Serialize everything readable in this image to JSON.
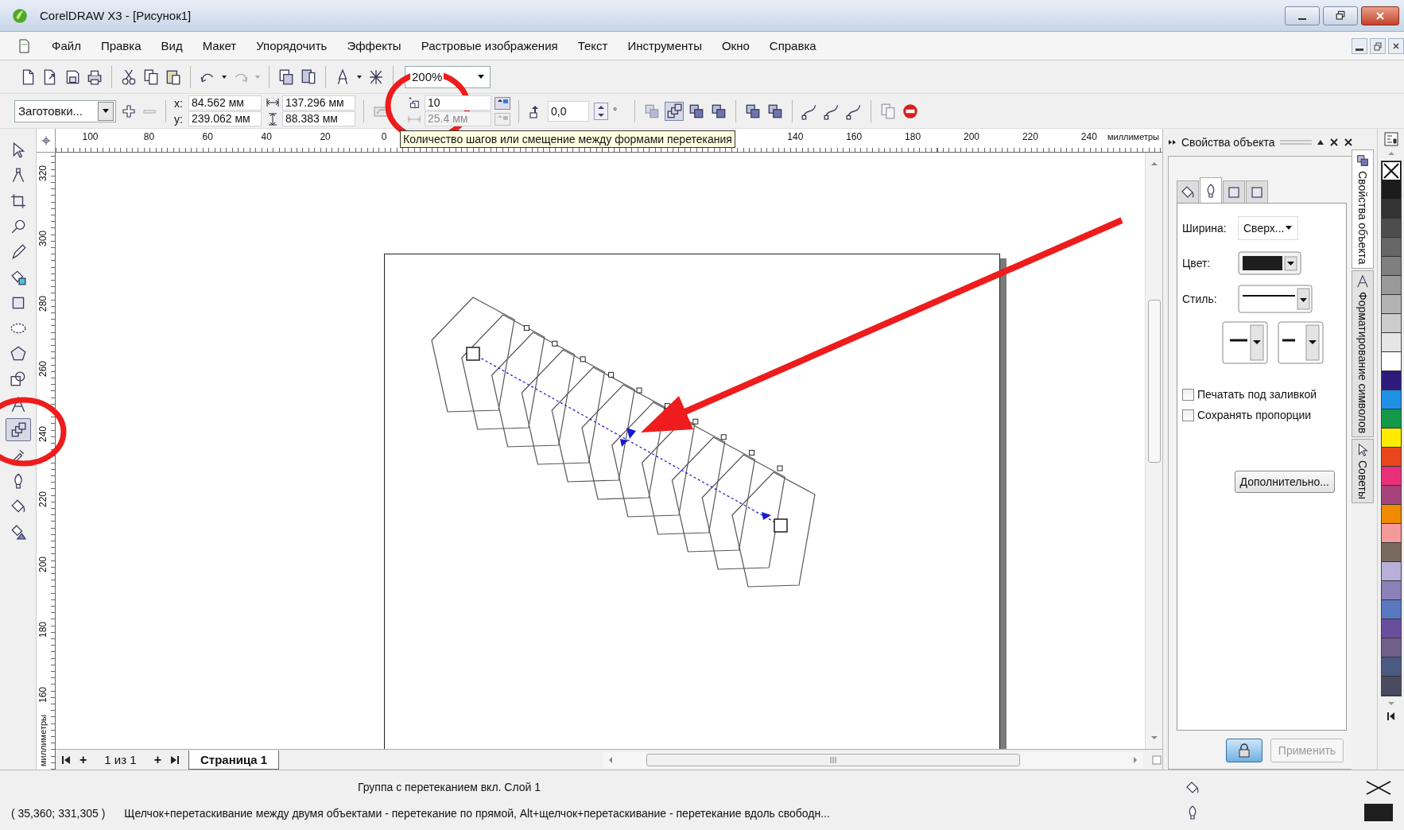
{
  "window": {
    "title": "CorelDRAW X3 - [Рисунок1]"
  },
  "menu": [
    "Файл",
    "Правка",
    "Вид",
    "Макет",
    "Упорядочить",
    "Эффекты",
    "Растровые изображения",
    "Текст",
    "Инструменты",
    "Окно",
    "Справка"
  ],
  "standard_toolbar": {
    "zoom": "200%"
  },
  "property_bar": {
    "preset": "Заготовки...",
    "x_label": "x:",
    "x": "84.562 мм",
    "y_label": "y:",
    "y": "239.062 мм",
    "width": "137.296 мм",
    "height": "88.383 мм",
    "steps": "10",
    "offset": {
      "value": "25.4 мм",
      "disabled": true
    },
    "angle": "0,0",
    "degree": "°"
  },
  "tooltip": "Количество шагов или смещение между формами перетекания",
  "horizontal_ruler": {
    "labels": [
      "100",
      "80",
      "60",
      "40",
      "20",
      "0",
      "140",
      "160",
      "180",
      "200",
      "220",
      "240"
    ],
    "unit": "миллиметры"
  },
  "vertical_ruler": {
    "labels": [
      "320",
      "300",
      "280",
      "260",
      "240",
      "220",
      "200",
      "180",
      "160"
    ],
    "unit": "миллиметры"
  },
  "toolbox": [
    {
      "selected": false
    },
    {
      "selected": false
    },
    {
      "selected": false
    },
    {
      "selected": false
    },
    {
      "selected": false
    },
    {
      "selected": false
    },
    {
      "selected": false
    },
    {
      "selected": false
    },
    {
      "selected": false
    },
    {
      "selected": false
    },
    {
      "selected": false
    },
    {
      "selected": true
    },
    {
      "selected": false
    },
    {
      "selected": false
    },
    {
      "selected": false
    },
    {
      "selected": false
    }
  ],
  "page_navigator": {
    "add_before": "+",
    "page_count": "1 из 1",
    "add_after": "+",
    "tabs": [
      {
        "label": "Страница 1",
        "selected": true
      }
    ]
  },
  "docker": {
    "title": "Свойства объекта",
    "tabs": [
      {
        "selected": false
      },
      {
        "selected": true
      },
      {
        "selected": false
      },
      {
        "selected": false
      }
    ],
    "width_label": "Ширина:",
    "width_value": "Сверх...",
    "color_label": "Цвет:",
    "style_label": "Стиль:",
    "checkboxes": [
      {
        "label": "Печатать под заливкой",
        "checked": false
      },
      {
        "label": "Сохранять пропорции",
        "checked": false
      }
    ],
    "advanced_button": "Дополнительно...",
    "apply_button": {
      "label": "Применить",
      "disabled": true
    }
  },
  "side_tabs": [
    {
      "label": "Свойства объекта",
      "selected": true
    },
    {
      "label": "Форматирование символов",
      "selected": false
    },
    {
      "label": "Советы",
      "selected": false
    }
  ],
  "palette": [
    {
      "kind": "none"
    },
    {
      "kind": "swatch",
      "color": "#1c1c1c"
    },
    {
      "kind": "swatch",
      "color": "#333333"
    },
    {
      "kind": "swatch",
      "color": "#4d4d4d"
    },
    {
      "kind": "swatch",
      "color": "#666666"
    },
    {
      "kind": "swatch",
      "color": "#7f7f7f"
    },
    {
      "kind": "swatch",
      "color": "#999999"
    },
    {
      "kind": "swatch",
      "color": "#b3b3b3"
    },
    {
      "kind": "swatch",
      "color": "#cccccc"
    },
    {
      "kind": "swatch",
      "color": "#e5e5e5"
    },
    {
      "kind": "swatch",
      "color": "#ffffff"
    },
    {
      "kind": "swatch",
      "color": "#2e1a7a"
    },
    {
      "kind": "swatch",
      "color": "#1e90e6"
    },
    {
      "kind": "swatch",
      "color": "#13994a"
    },
    {
      "kind": "swatch",
      "color": "#ffeb00"
    },
    {
      "kind": "swatch",
      "color": "#e8461c"
    },
    {
      "kind": "swatch",
      "color": "#e8307a"
    },
    {
      "kind": "swatch",
      "color": "#a54379"
    },
    {
      "kind": "swatch",
      "color": "#f08a00"
    },
    {
      "kind": "swatch",
      "color": "#f59a9a"
    },
    {
      "kind": "swatch",
      "color": "#7a6a5e"
    },
    {
      "kind": "swatch",
      "color": "#b8b0d8"
    },
    {
      "kind": "swatch",
      "color": "#8b80b8"
    },
    {
      "kind": "swatch",
      "color": "#5a78c0"
    },
    {
      "kind": "swatch",
      "color": "#6a4e9e"
    },
    {
      "kind": "swatch",
      "color": "#70608a"
    },
    {
      "kind": "swatch",
      "color": "#4a5a80"
    },
    {
      "kind": "swatch",
      "color": "#4a4a60"
    }
  ],
  "status_bar": {
    "object_info": "Группа с перетеканием вкл. Слой 1",
    "coordinates": "( 35,360; 331,305 )",
    "hint": "Щелчок+перетаскивание между двумя объектами - перетекание по прямой, Alt+щелчок+перетаскивание - перетекание вдоль свободн..."
  }
}
